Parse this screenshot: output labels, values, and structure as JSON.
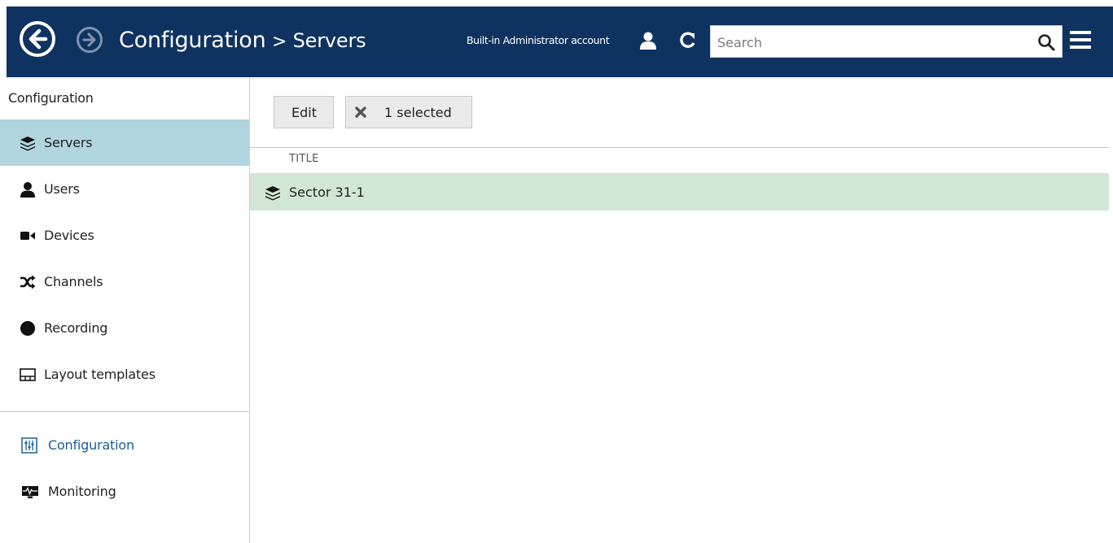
{
  "header": {
    "title": "Configuration",
    "separator": ">",
    "section": "Servers",
    "account": "Built-in Administrator account",
    "search_placeholder": "Search"
  },
  "sidebar": {
    "heading": "Configuration",
    "items": [
      {
        "label": "Servers",
        "icon": "servers-icon",
        "active": true
      },
      {
        "label": "Users",
        "icon": "user-icon"
      },
      {
        "label": "Devices",
        "icon": "camera-icon"
      },
      {
        "label": "Channels",
        "icon": "shuffle-icon"
      },
      {
        "label": "Recording",
        "icon": "record-icon"
      },
      {
        "label": "Layout templates",
        "icon": "layout-icon"
      }
    ],
    "modes": [
      {
        "label": "Configuration",
        "icon": "sliders-icon",
        "active": true
      },
      {
        "label": "Monitoring",
        "icon": "monitoring-icon"
      }
    ]
  },
  "toolbar": {
    "edit_label": "Edit",
    "selected_label": "1 selected"
  },
  "table": {
    "column_title": "TITLE",
    "rows": [
      {
        "title": "Sector 31-1",
        "icon": "servers-icon",
        "selected": true
      }
    ]
  },
  "colors": {
    "header_bg": "#0f3360",
    "active_nav_bg": "#b1d5de",
    "selected_row_bg": "#d2e6d6",
    "mode_active_text": "#1c5e90"
  }
}
